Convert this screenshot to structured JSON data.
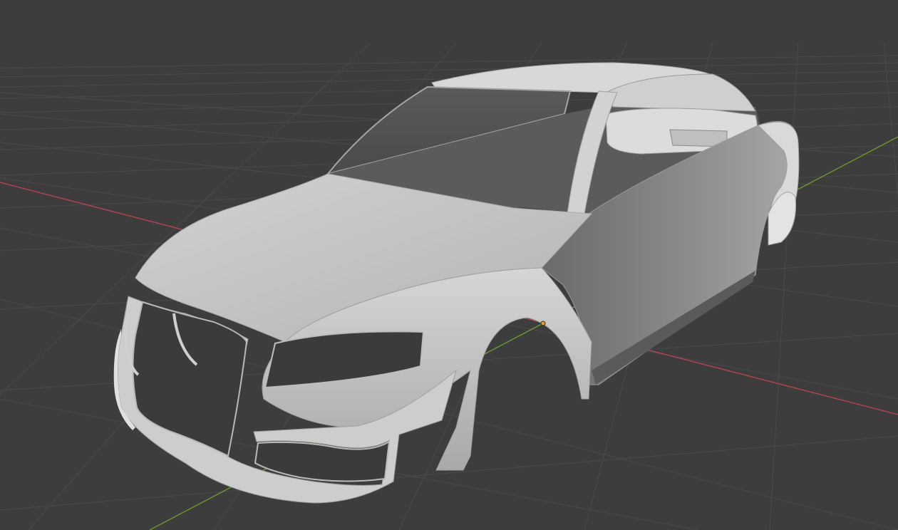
{
  "viewport": {
    "background": "#3d3d3d",
    "grid_color": "#4a4a4a",
    "x_axis_color": "#b5444f",
    "y_axis_color": "#6b9a2e",
    "origin_color": "#f2a21b",
    "model_color": "#c9c9c9",
    "model_shadow_color": "#6c6c6c",
    "opening_color": "#3a3a3a"
  },
  "scene": {
    "object": "car-body-mesh",
    "view": "perspective",
    "shading": "solid"
  }
}
